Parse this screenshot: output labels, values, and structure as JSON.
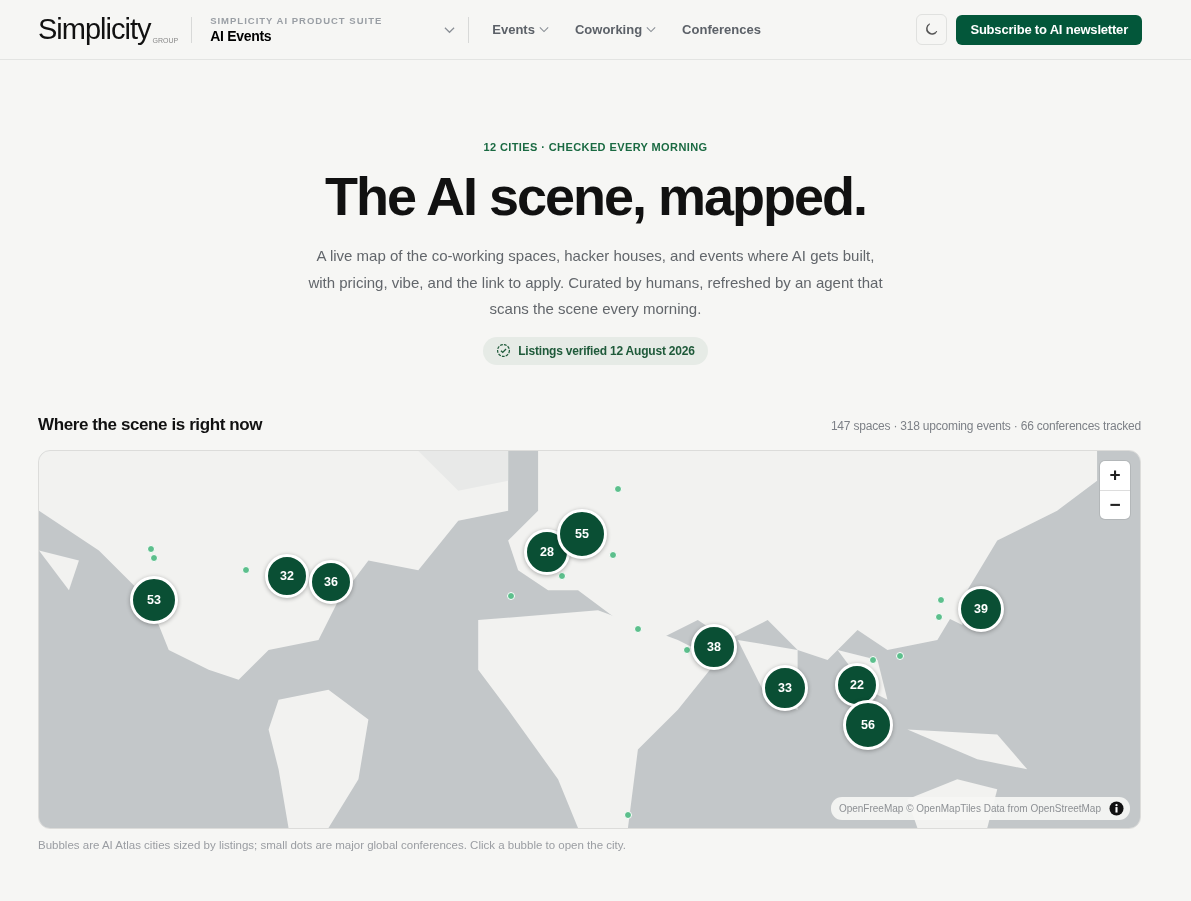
{
  "header": {
    "logo": "Simplicity",
    "logo_sub": "GROUP",
    "suite_label": "SIMPLICITY AI PRODUCT SUITE",
    "suite_name": "AI Events",
    "nav": [
      {
        "label": "Events",
        "dropdown": true
      },
      {
        "label": "Coworking",
        "dropdown": true
      },
      {
        "label": "Conferences",
        "dropdown": false
      }
    ],
    "subscribe": "Subscribe to AI newsletter"
  },
  "hero": {
    "eyebrow": "12 CITIES · CHECKED EVERY MORNING",
    "title": "The AI scene, mapped.",
    "lead": "A live map of the co-working spaces, hacker houses, and events where AI gets built, with pricing, vibe, and the link to apply. Curated by humans, refreshed by an agent that scans the scene every morning.",
    "verified": "Listings verified 12 August 2026"
  },
  "map_section": {
    "title": "Where the scene is right now",
    "stats": "147 spaces · 318 upcoming events · 66 conferences tracked",
    "map": {
      "kind": "picture",
      "clusters": [
        {
          "count": "53"
        },
        {
          "count": "32"
        },
        {
          "count": "36"
        },
        {
          "count": "28"
        },
        {
          "count": "55"
        },
        {
          "count": "38"
        },
        {
          "count": "33"
        },
        {
          "count": "22"
        },
        {
          "count": "56"
        },
        {
          "count": "39"
        }
      ],
      "zoom_in": "+",
      "zoom_out": "−",
      "attribution": "OpenFreeMap © OpenMapTiles Data from OpenStreetMap"
    },
    "caption": "Bubbles are AI Atlas cities sized by listings; small dots are major global conferences. Click a bubble to open the city."
  }
}
